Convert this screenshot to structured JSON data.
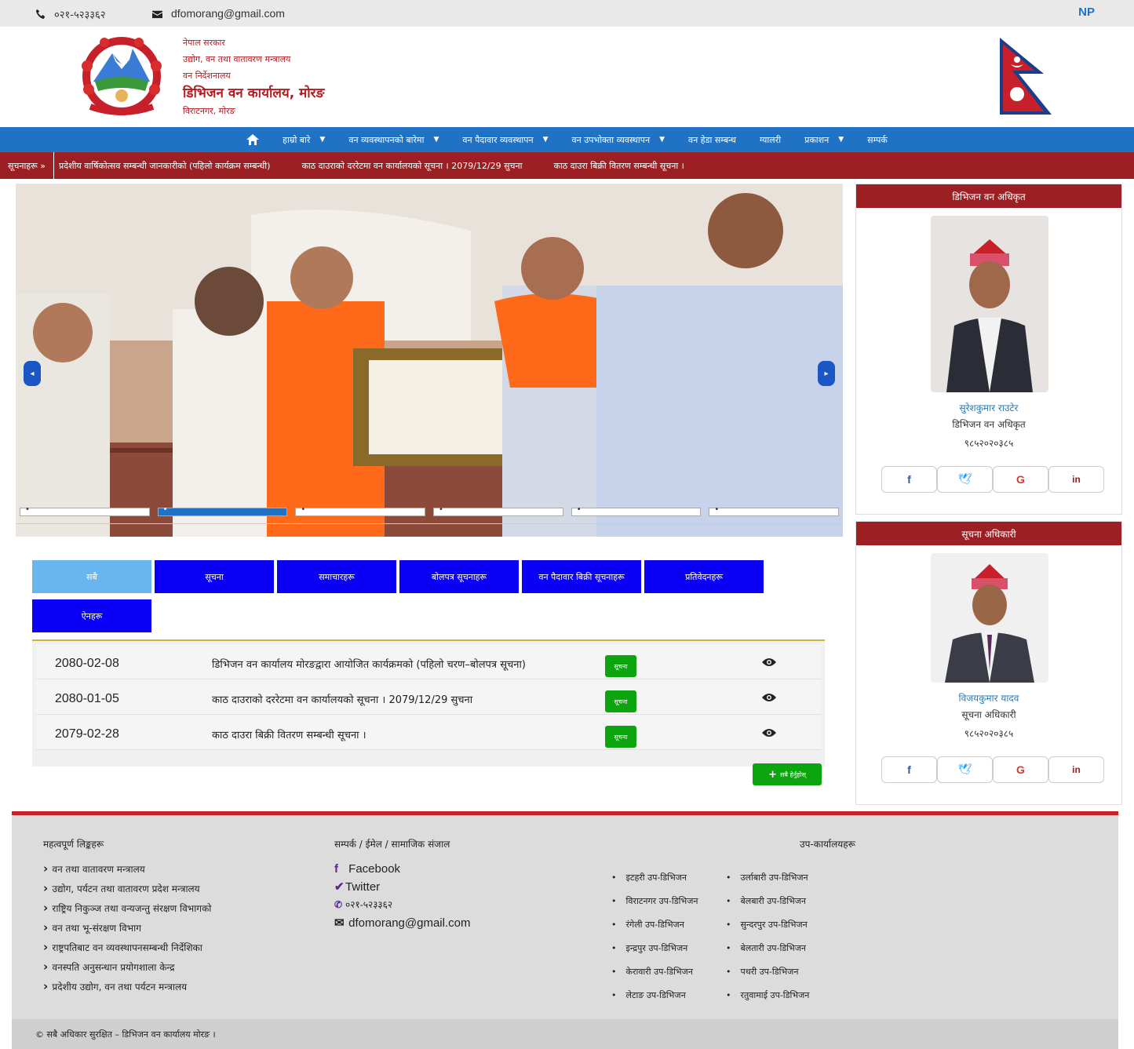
{
  "topbar": {
    "phone": "०२१-५२३३६२",
    "email": "dfomorang@gmail.com",
    "lang": "NP"
  },
  "header": {
    "line1": "नेपाल सरकार",
    "line2": "उद्योग, वन तथा वातावरण मन्त्रालय",
    "line3": "वन निर्देशनालय",
    "office": "डिभिजन वन कार्यालय, मोरङ",
    "address": "विराटनगर, मोरङ"
  },
  "nav": {
    "items": [
      {
        "label": "",
        "icon": "home-icon"
      },
      {
        "label": "हाम्रो बारे",
        "caret": true
      },
      {
        "label": "वन व्यवस्थापनको बारेमा",
        "caret": true
      },
      {
        "label": "वन पैदावार व्यवस्थापन",
        "caret": true
      },
      {
        "label": "वन उपभोक्ता व्यवस्थापन",
        "caret": true
      },
      {
        "label": "वन हेडा सम्बन्ध",
        "caret": false
      },
      {
        "label": "ग्यालरी",
        "caret": false
      },
      {
        "label": "प्रकाशन",
        "caret": true
      },
      {
        "label": "सम्पर्क",
        "caret": false
      }
    ]
  },
  "ticker": {
    "label": "सूचनाहरू »",
    "items": [
      "प्रदेशीय वार्षिकोत्सव सम्बन्धी जानकारीको (पहिलो कार्यक्रम सम्बन्धी)",
      "काठ दाउराको दररेटमा वन कार्यालयको सूचना । 2079/12/29 सुचना",
      "काठ दाउरा बिक्री वितरण सम्बन्धी सूचना ।"
    ]
  },
  "slider": {
    "prev_icon": "chevron-left-icon",
    "next_icon": "chevron-right-icon",
    "slides": 6,
    "active": 2
  },
  "tabs": [
    {
      "label": "सबै",
      "active": true
    },
    {
      "label": "सूचना"
    },
    {
      "label": "समाचारहरू"
    },
    {
      "label": "बोलपत्र सूचनाहरू"
    },
    {
      "label": "वन पैदावार बिक्री सूचनाहरू"
    },
    {
      "label": "प्रतिवेदनहरू"
    },
    {
      "label": "ऐनहरू"
    }
  ],
  "notices": [
    {
      "date": "2080-02-08",
      "title": "डिभिजन वन कार्यालय मोरङद्वारा आयोजित कार्यक्रमको (पहिलो चरण–बोलपत्र सूचना)",
      "button": "सूचना"
    },
    {
      "date": "2080-01-05",
      "title": "काठ दाउराको दररेटमा वन कार्यालयको सूचना । 2079/12/29 सुचना",
      "button": "सूचना"
    },
    {
      "date": "2079-02-28",
      "title": "काठ दाउरा बिक्री वितरण सम्बन्धी सूचना ।",
      "button": "सूचना"
    }
  ],
  "view_all": "सबै हेर्नुहोस्",
  "cards": [
    {
      "heading": "डिभिजन वन अधिकृत",
      "name": "सुरेशकुमार राउटेर",
      "role": "डिभिजन वन अधिकृत",
      "phone": "९८५२०२०३८५"
    },
    {
      "heading": "सूचना अधिकारी",
      "name": "विजयकुमार यादव",
      "role": "सूचना अधिकारी",
      "phone": "९८५२०२०३८५"
    }
  ],
  "social_icons": [
    "facebook-icon",
    "twitter-icon",
    "google-icon",
    "linkedin-icon"
  ],
  "footer": {
    "col1_title": "महत्वपूर्ण लिङ्कहरू",
    "col1_links": [
      "वन तथा वातावरण मन्त्रालय",
      "उद्योग, पर्यटन तथा वातावरण प्रदेश मन्त्रालय",
      "राष्ट्रिय निकुञ्ज तथा वन्यजन्तु संरक्षण विभागको",
      "वन तथा भू-संरक्षण विभाग",
      "राष्ट्रपतिबाट वन व्यवस्थापनसम्बन्धी निर्देशिका",
      "वनस्पति अनुसन्धान प्रयोगशाला केन्द्र",
      "प्रदेशीय उद्योग, वन तथा पर्यटन मन्त्रालय"
    ],
    "col2_title": "सम्पर्क / ईमेल / सामाजिक संजाल",
    "facebook": "Facebook",
    "twitter": "Twitter",
    "phone": "०२१-५२३३६२",
    "email": "dfomorang@gmail.com",
    "col3_title": "उप-कार्यालयहरू",
    "offices_left": [
      "इटहरी उप-डिभिजन",
      "विराटनगर उप-डिभिजन",
      "रंगेली उप-डिभिजन",
      "इन्द्रपुर उप-डिभिजन",
      "केरावारी उप-डिभिजन",
      "लेटाङ उप-डिभिजन"
    ],
    "offices_right": [
      "उर्लाबारी उप-डिभिजन",
      "बेलबारी उप-डिभिजन",
      "सुन्दरपुर उप-डिभिजन",
      "बेलतारी उप-डिभिजन",
      "पथरी उप-डिभिजन",
      "रतुवामाई उप-डिभिजन"
    ]
  },
  "copyright": "© सबै अधिकार सुरक्षित – डिभिजन वन कार्यालय मोरङ ।"
}
